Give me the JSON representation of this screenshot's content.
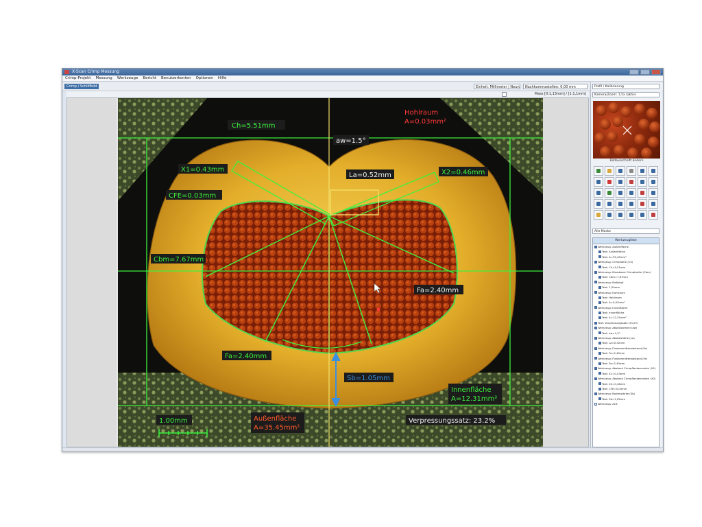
{
  "window": {
    "title": "X-Scan Crimp Messung",
    "controls": [
      "minimize",
      "maximize",
      "close"
    ]
  },
  "menu": [
    "Crimp-Projekt",
    "Messung",
    "Werkzeuge",
    "Bericht",
    "Benutzerkonten",
    "Optionen",
    "Hilfe"
  ],
  "toolbar": {
    "tab_label": "Crimp / Schliffbild",
    "unit_combo": "Einheit: Millimeter | Neuron",
    "filter_combo": "Nachkommastellen: 0,00 mm",
    "profile_combo": "Profil / Kalibrierung"
  },
  "massbar": {
    "mass_label": "Mass [0:1,13mm] / [1:1,1mm]"
  },
  "right_panel": {
    "camera_label": "Kamera/Zoom: 1,5x (aktiv)",
    "preview_caption": "Bildausschnitt ändern",
    "list_combo": "Alle Maske",
    "list_header": "Werkzeugliste",
    "list": [
      {
        "text": "Werkzeug: Außenfläche",
        "checked": true,
        "indent": 0
      },
      {
        "text": "Text: Außenfläche",
        "checked": true,
        "indent": 1
      },
      {
        "text": "Text: A=35,45mm²",
        "checked": true,
        "indent": 1
      },
      {
        "text": "Werkzeug: Crimphöhe (Ch)",
        "checked": true,
        "indent": 0
      },
      {
        "text": "Text: Ch=5,51mm",
        "checked": true,
        "indent": 1
      },
      {
        "text": "Werkzeug: Messbasis Crimpbreite (Cbm)",
        "checked": true,
        "indent": 0
      },
      {
        "text": "Text: Cbm=7,67mm",
        "checked": true,
        "indent": 1
      },
      {
        "text": "Werkzeug: Maßstab",
        "checked": true,
        "indent": 0
      },
      {
        "text": "Text: 1,00mm",
        "checked": true,
        "indent": 1
      },
      {
        "text": "Werkzeug: Hohlraum",
        "checked": true,
        "indent": 0
      },
      {
        "text": "Text: Hohlraum",
        "checked": true,
        "indent": 1
      },
      {
        "text": "Text: A=0,03mm²",
        "checked": true,
        "indent": 1
      },
      {
        "text": "Werkzeug: Innenfläche",
        "checked": true,
        "indent": 0
      },
      {
        "text": "Text: Innenfläche",
        "checked": true,
        "indent": 1
      },
      {
        "text": "Text: A=12,31mm²",
        "checked": true,
        "indent": 1
      },
      {
        "text": "Text: Verpressungssatz: 23,2%",
        "checked": true,
        "indent": 0
      },
      {
        "text": "Werkzeug: Abstützwinkel (aw)",
        "checked": true,
        "indent": 0
      },
      {
        "text": "Text: aw=1,5°",
        "checked": true,
        "indent": 1
      },
      {
        "text": "Werkzeug: Abstützhöhe (La)",
        "checked": true,
        "indent": 0
      },
      {
        "text": "Text: La=0,52mm",
        "checked": true,
        "indent": 1
      },
      {
        "text": "Werkzeug: Flankenmittenabstand (Fa)",
        "checked": true,
        "indent": 0
      },
      {
        "text": "Text: Fa=2,40mm",
        "checked": true,
        "indent": 1
      },
      {
        "text": "Werkzeug: Flankenmittenabstand (Fa)",
        "checked": true,
        "indent": 0
      },
      {
        "text": "Text: Fa=2,40mm",
        "checked": true,
        "indent": 1
      },
      {
        "text": "Werkzeug: Abstand Crimpflankenenden (X1)",
        "checked": true,
        "indent": 0
      },
      {
        "text": "Text: X1=0,43mm",
        "checked": true,
        "indent": 1
      },
      {
        "text": "Werkzeug: Abstand Crimpflankenenden (X2)",
        "checked": true,
        "indent": 0
      },
      {
        "text": "Text: X2=0,46mm",
        "checked": true,
        "indent": 1
      },
      {
        "text": "Text: CFE=0,03mm",
        "checked": true,
        "indent": 1
      },
      {
        "text": "Werkzeug: Bodenstärke (Sb)",
        "checked": true,
        "indent": 0
      },
      {
        "text": "Text: Sb=1,05mm",
        "checked": true,
        "indent": 1
      },
      {
        "text": "Werkzeug: ACE",
        "checked": false,
        "indent": 0
      }
    ]
  },
  "measurements": {
    "ch": "Ch=5.51mm",
    "aw": "aw=1.5°",
    "hohlraum_title": "Hohlraum",
    "hohlraum_area": "A=0.03mm²",
    "x1": "X1=0.43mm",
    "x2": "X2=0.46mm",
    "la": "La=0.52mm",
    "cfe": "CFE=0.03mm",
    "cbm": "Cbm=7.67mm",
    "fa_right": "Fa=2.40mm",
    "fa_left": "Fa=2.40mm",
    "sb": "Sb=1.05mm",
    "innen_title": "Innenfläche",
    "innen_area": "A=12.31mm²",
    "scale": "1.00mm",
    "aussen_title": "Außenfläche",
    "aussen_area": "A=35.45mm²",
    "verpressung": "Verpressungssatz: 23.2%"
  },
  "colors": {
    "measure_line": "#3df23d",
    "label_text": "#3df23d",
    "label_bg": "#1c1c1c",
    "accent_red": "#ff3a3a",
    "sb_arrow": "#3b8fe0",
    "copper": "#a8320c",
    "crimp_gold": "#f0c23c"
  }
}
